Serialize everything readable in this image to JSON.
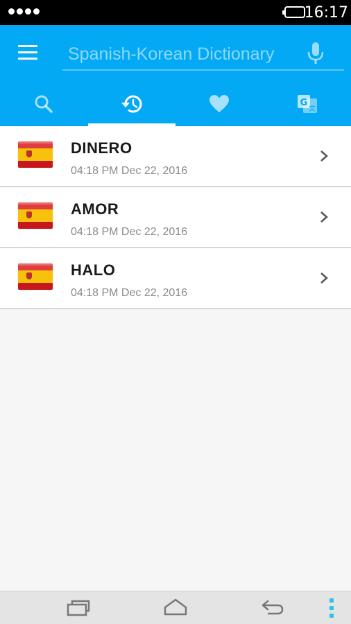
{
  "status_bar": {
    "time": "16:17",
    "signal_icon": "signal-dots-icon",
    "battery_icon": "battery-icon"
  },
  "app_bar": {
    "background_color": "#03a9f4",
    "menu_icon": "hamburger-menu-icon",
    "search": {
      "placeholder": "Spanish-Korean Dictionary",
      "value": ""
    },
    "mic_icon": "microphone-icon"
  },
  "tabs": [
    {
      "id": "search",
      "icon": "search-icon",
      "active": false
    },
    {
      "id": "history",
      "icon": "history-icon",
      "active": true
    },
    {
      "id": "favorites",
      "icon": "heart-icon",
      "active": false
    },
    {
      "id": "translate",
      "icon": "translate-icon",
      "active": false
    }
  ],
  "history": [
    {
      "word": "DINERO",
      "time": "04:18 PM Dec 22, 2016",
      "flag_icon": "spain-flag-icon"
    },
    {
      "word": "AMOR",
      "time": "04:18 PM Dec 22, 2016",
      "flag_icon": "spain-flag-icon"
    },
    {
      "word": "HALO",
      "time": "04:18 PM Dec 22, 2016",
      "flag_icon": "spain-flag-icon"
    }
  ],
  "nav_bar": {
    "buttons": [
      "recent-apps-icon",
      "home-icon",
      "back-icon",
      "more-options-icon"
    ]
  }
}
